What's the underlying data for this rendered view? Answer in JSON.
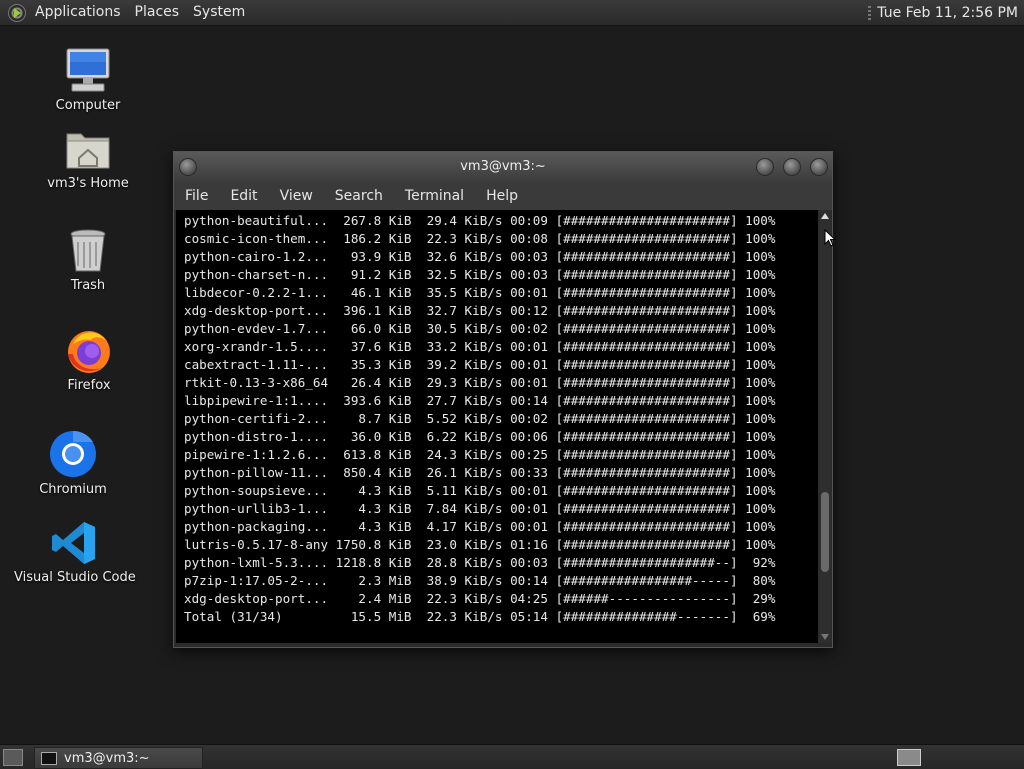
{
  "top_panel": {
    "menus": [
      "Applications",
      "Places",
      "System"
    ],
    "clock": "Tue Feb 11,  2:56 PM"
  },
  "desktop_icons": [
    {
      "label": "Computer",
      "icon": "computer-icon"
    },
    {
      "label": "vm3's Home",
      "icon": "home-folder-icon"
    },
    {
      "label": "Trash",
      "icon": "trash-icon"
    },
    {
      "label": "Firefox",
      "icon": "firefox-icon"
    },
    {
      "label": "Chromium",
      "icon": "chromium-icon"
    },
    {
      "label": "Visual Studio Code",
      "icon": "vscode-icon"
    }
  ],
  "terminal": {
    "title": "vm3@vm3:~",
    "menu": [
      "File",
      "Edit",
      "View",
      "Search",
      "Terminal",
      "Help"
    ],
    "scroll_position": 0.82,
    "lines": [
      {
        "name": "python-beautiful...",
        "size": "267.8 KiB",
        "speed": "29.4 KiB/s",
        "time": "00:09",
        "bar": "[######################]",
        "pct": "100%"
      },
      {
        "name": "cosmic-icon-them...",
        "size": "186.2 KiB",
        "speed": "22.3 KiB/s",
        "time": "00:08",
        "bar": "[######################]",
        "pct": "100%"
      },
      {
        "name": "python-cairo-1.2...",
        "size": "93.9 KiB",
        "speed": "32.6 KiB/s",
        "time": "00:03",
        "bar": "[######################]",
        "pct": "100%"
      },
      {
        "name": "python-charset-n...",
        "size": "91.2 KiB",
        "speed": "32.5 KiB/s",
        "time": "00:03",
        "bar": "[######################]",
        "pct": "100%"
      },
      {
        "name": "libdecor-0.2.2-1...",
        "size": "46.1 KiB",
        "speed": "35.5 KiB/s",
        "time": "00:01",
        "bar": "[######################]",
        "pct": "100%"
      },
      {
        "name": "xdg-desktop-port...",
        "size": "396.1 KiB",
        "speed": "32.7 KiB/s",
        "time": "00:12",
        "bar": "[######################]",
        "pct": "100%"
      },
      {
        "name": "python-evdev-1.7...",
        "size": "66.0 KiB",
        "speed": "30.5 KiB/s",
        "time": "00:02",
        "bar": "[######################]",
        "pct": "100%"
      },
      {
        "name": "xorg-xrandr-1.5....",
        "size": "37.6 KiB",
        "speed": "33.2 KiB/s",
        "time": "00:01",
        "bar": "[######################]",
        "pct": "100%"
      },
      {
        "name": "cabextract-1.11-...",
        "size": "35.3 KiB",
        "speed": "39.2 KiB/s",
        "time": "00:01",
        "bar": "[######################]",
        "pct": "100%"
      },
      {
        "name": "rtkit-0.13-3-x86_64",
        "size": "26.4 KiB",
        "speed": "29.3 KiB/s",
        "time": "00:01",
        "bar": "[######################]",
        "pct": "100%"
      },
      {
        "name": "libpipewire-1:1....",
        "size": "393.6 KiB",
        "speed": "27.7 KiB/s",
        "time": "00:14",
        "bar": "[######################]",
        "pct": "100%"
      },
      {
        "name": "python-certifi-2...",
        "size": "8.7 KiB",
        "speed": "5.52 KiB/s",
        "time": "00:02",
        "bar": "[######################]",
        "pct": "100%"
      },
      {
        "name": "python-distro-1....",
        "size": "36.0 KiB",
        "speed": "6.22 KiB/s",
        "time": "00:06",
        "bar": "[######################]",
        "pct": "100%"
      },
      {
        "name": "pipewire-1:1.2.6...",
        "size": "613.8 KiB",
        "speed": "24.3 KiB/s",
        "time": "00:25",
        "bar": "[######################]",
        "pct": "100%"
      },
      {
        "name": "python-pillow-11...",
        "size": "850.4 KiB",
        "speed": "26.1 KiB/s",
        "time": "00:33",
        "bar": "[######################]",
        "pct": "100%"
      },
      {
        "name": "python-soupsieve...",
        "size": "4.3 KiB",
        "speed": "5.11 KiB/s",
        "time": "00:01",
        "bar": "[######################]",
        "pct": "100%"
      },
      {
        "name": "python-urllib3-1...",
        "size": "4.3 KiB",
        "speed": "7.84 KiB/s",
        "time": "00:01",
        "bar": "[######################]",
        "pct": "100%"
      },
      {
        "name": "python-packaging...",
        "size": "4.3 KiB",
        "speed": "4.17 KiB/s",
        "time": "00:01",
        "bar": "[######################]",
        "pct": "100%"
      },
      {
        "name": "lutris-0.5.17-8-any",
        "size": "1750.8 KiB",
        "speed": "23.0 KiB/s",
        "time": "01:16",
        "bar": "[######################]",
        "pct": "100%"
      },
      {
        "name": "python-lxml-5.3....",
        "size": "1218.8 KiB",
        "speed": "28.8 KiB/s",
        "time": "00:03",
        "bar": "[####################--]",
        "pct": "92%"
      },
      {
        "name": "p7zip-1:17.05-2-...",
        "size": "2.3 MiB",
        "speed": "38.9 KiB/s",
        "time": "00:14",
        "bar": "[#################-----]",
        "pct": "80%"
      },
      {
        "name": "xdg-desktop-port...",
        "size": "2.4 MiB",
        "speed": "22.3 KiB/s",
        "time": "04:25",
        "bar": "[######----------------]",
        "pct": "29%"
      },
      {
        "name": "Total (31/34)",
        "size": "15.5 MiB",
        "speed": "22.3 KiB/s",
        "time": "05:14",
        "bar": "[###############-------]",
        "pct": "69%"
      }
    ]
  },
  "taskbar": {
    "task_label": "vm3@vm3:~"
  }
}
